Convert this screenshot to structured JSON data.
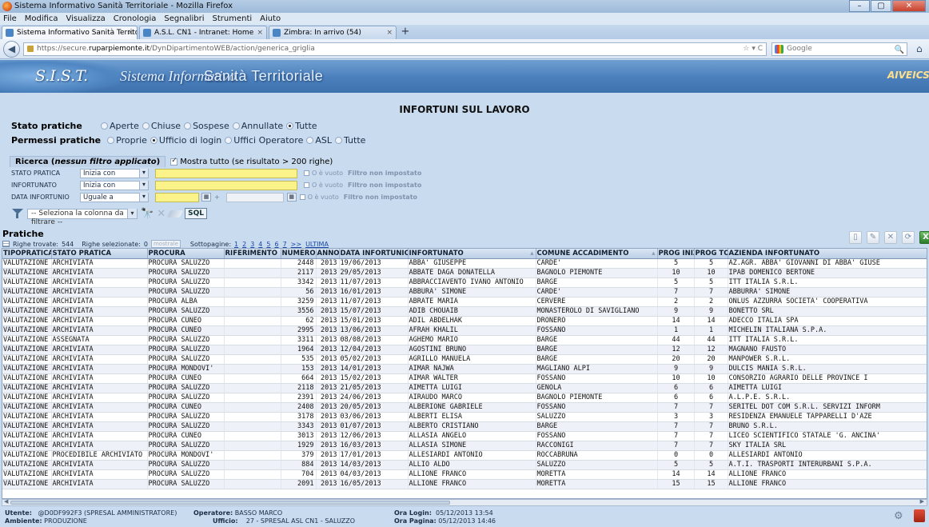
{
  "browser": {
    "window_title": "Sistema Informativo Sanità Territoriale - Mozilla Firefox",
    "controls": {
      "minimize": "–",
      "maximize": "▢",
      "close": "✕"
    },
    "menu": [
      "File",
      "Modifica",
      "Visualizza",
      "Cronologia",
      "Segnalibri",
      "Strumenti",
      "Aiuto"
    ],
    "tabs": [
      {
        "label": "Sistema Informativo Sanità Territoriale",
        "active": true
      },
      {
        "label": "A.S.L. CN1 - Intranet: Home",
        "active": false
      },
      {
        "label": "Zimbra: In arrivo (54)",
        "active": false
      }
    ],
    "tab_close": "×",
    "new_tab": "+",
    "url_prefix": "https://secure.",
    "url_domain": "ruparpiemonte.it",
    "url_path": "/DynDipartimentoWEB/action/generica_griglia",
    "url_right": "☆ ▾ C",
    "search_placeholder": "Google",
    "back": "◀",
    "search_button": "🔍",
    "home": "⌂"
  },
  "header": {
    "logo": "S.I.S.T.",
    "title_italic": "Sistema Informativo",
    "title_main": "Sanità Territoriale",
    "vendor": "AIVEICS"
  },
  "page": {
    "title": "INFORTUNI SUL LAVORO"
  },
  "stato": {
    "label": "Stato pratiche",
    "options": [
      "Aperte",
      "Chiuse",
      "Sospese",
      "Annullate",
      "Tutte"
    ],
    "selected": 4
  },
  "permessi": {
    "label": "Permessi pratiche",
    "options": [
      "Proprie",
      "Ufficio di login",
      "Uffici Operatore",
      "ASL",
      "Tutte"
    ],
    "selected": 1
  },
  "ricerca": {
    "title_prefix": "Ricerca (",
    "title_em": "nessun filtro applicato",
    "title_suffix": ")",
    "show_all": "Mostra tutto (se risultato > 200 righe)",
    "show_all_checked": true,
    "criteria": [
      {
        "label": "STATO PRATICA",
        "op": "Inizia con",
        "empty": "O è vuoto",
        "status": "Filtro non impostato"
      },
      {
        "label": "INFORTUNATO",
        "op": "Inizia con",
        "empty": "O è vuoto",
        "status": "Filtro non impostato"
      },
      {
        "label": "DATA INFORTUNIO",
        "op": "Uguale a",
        "plus": "+",
        "empty": "O è vuoto",
        "status": "Filtro non impostato"
      }
    ],
    "column_select": "-- Seleziona la colonna da filtrare --",
    "sql_label": "SQL"
  },
  "pratiche": {
    "title": "Pratiche",
    "rows_found_label": "Righe trovate:",
    "rows_found": "544",
    "rows_selected_label": "Righe selezionate:",
    "rows_selected": "0",
    "show_button": "mostrale",
    "subpages_label": "Sottopagine:",
    "subpages": [
      "1",
      "2",
      "3",
      "4",
      "5",
      "6",
      "7",
      ">>",
      "ULTIMA"
    ]
  },
  "grid": {
    "columns": [
      "TIPOPRATICA",
      "STATO PRATICA",
      "PROCURA",
      "RIFERIMENTO",
      "NUMERO",
      "ANNO",
      "DATA INFORTUNIO",
      "INFORTUNATO",
      "COMUNE ACCADIMENTO",
      "PROG INIZ",
      "PROG TOT",
      "AZIENDA INFORTUNATO"
    ],
    "sort_marks": {
      "INFORTUNATO": "▴",
      "COMUNE ACCADIMENTO": "▴"
    },
    "rows": [
      [
        "VALUTAZIONE",
        "ARCHIVIATA",
        "PROCURA SALUZZO",
        "",
        "2448",
        "2013",
        "19/06/2013",
        "ABBA' GIUSEPPE",
        "CARDE'",
        "5",
        "5",
        "AZ.AGR. ABBA' GIOVANNI DI ABBA' GIUSE"
      ],
      [
        "VALUTAZIONE",
        "ARCHIVIATA",
        "PROCURA SALUZZO",
        "",
        "2117",
        "2013",
        "29/05/2013",
        "ABBATE DAGA DONATELLA",
        "BAGNOLO PIEMONTE",
        "10",
        "10",
        "IPAB DOMENICO BERTONE"
      ],
      [
        "VALUTAZIONE",
        "ARCHIVIATA",
        "PROCURA SALUZZO",
        "",
        "3342",
        "2013",
        "11/07/2013",
        "ABBRACCIAVENTO IVANO ANTONIO",
        "BARGE",
        "5",
        "5",
        "ITT ITALIA S.R.L."
      ],
      [
        "VALUTAZIONE",
        "ARCHIVIATA",
        "PROCURA SALUZZO",
        "",
        "56",
        "2013",
        "16/01/2013",
        "ABBURA' SIMONE",
        "CARDE'",
        "7",
        "7",
        "ABBURRA' SIMONE"
      ],
      [
        "VALUTAZIONE",
        "ARCHIVIATA",
        "PROCURA ALBA",
        "",
        "3259",
        "2013",
        "11/07/2013",
        "ABRATE MARIA",
        "CERVERE",
        "2",
        "2",
        "ONLUS AZZURRA SOCIETA' COOPERATIVA"
      ],
      [
        "VALUTAZIONE",
        "ARCHIVIATA",
        "PROCURA SALUZZO",
        "",
        "3556",
        "2013",
        "15/07/2013",
        "ADIB CHOUAIB",
        "MONASTEROLO DI SAVIGLIANO",
        "9",
        "9",
        "BONETTO SRL"
      ],
      [
        "VALUTAZIONE",
        "ARCHIVIATA",
        "PROCURA CUNEO",
        "",
        "62",
        "2013",
        "15/01/2013",
        "ADIL ABDELHAK",
        "DRONERO",
        "14",
        "14",
        "ADECCO ITALIA SPA"
      ],
      [
        "VALUTAZIONE",
        "ARCHIVIATA",
        "PROCURA CUNEO",
        "",
        "2995",
        "2013",
        "13/06/2013",
        "AFRAH KHALIL",
        "FOSSANO",
        "1",
        "1",
        "MICHELIN ITALIANA S.P.A."
      ],
      [
        "VALUTAZIONE",
        "ASSEGNATA",
        "PROCURA SALUZZO",
        "",
        "3311",
        "2013",
        "08/08/2013",
        "AGHEMO MARIO",
        "BARGE",
        "44",
        "44",
        "ITT ITALIA S.R.L."
      ],
      [
        "VALUTAZIONE",
        "ARCHIVIATA",
        "PROCURA SALUZZO",
        "",
        "1964",
        "2013",
        "12/04/2013",
        "AGOSTINI BRUNO",
        "BARGE",
        "12",
        "12",
        "MAGNANO FAUSTO"
      ],
      [
        "VALUTAZIONE",
        "ARCHIVIATA",
        "PROCURA SALUZZO",
        "",
        "535",
        "2013",
        "05/02/2013",
        "AGRILLO MANUELA",
        "BARGE",
        "20",
        "20",
        "MANPOWER S.R.L."
      ],
      [
        "VALUTAZIONE",
        "ARCHIVIATA",
        "PROCURA MONDOVI'",
        "",
        "153",
        "2013",
        "14/01/2013",
        "AIMAR NAJWA",
        "MAGLIANO ALPI",
        "9",
        "9",
        "DULCIS MANIA S.R.L."
      ],
      [
        "VALUTAZIONE",
        "ARCHIVIATA",
        "PROCURA CUNEO",
        "",
        "664",
        "2013",
        "15/02/2013",
        "AIMAR WALTER",
        "FOSSANO",
        "10",
        "10",
        "CONSORZIO AGRARIO DELLE PROVINCE I"
      ],
      [
        "VALUTAZIONE",
        "ARCHIVIATA",
        "PROCURA SALUZZO",
        "",
        "2118",
        "2013",
        "21/05/2013",
        "AIMETTA LUIGI",
        "GENOLA",
        "6",
        "6",
        "AIMETTA LUIGI"
      ],
      [
        "VALUTAZIONE",
        "ARCHIVIATA",
        "PROCURA SALUZZO",
        "",
        "2391",
        "2013",
        "24/06/2013",
        "AIRAUDO MARCO",
        "BAGNOLO PIEMONTE",
        "6",
        "6",
        "A.L.P.E. S.R.L."
      ],
      [
        "VALUTAZIONE",
        "ARCHIVIATA",
        "PROCURA CUNEO",
        "",
        "2408",
        "2013",
        "20/05/2013",
        "ALBERIONE GABRIELE",
        "FOSSANO",
        "7",
        "7",
        "SERITEL DOT COM S.R.L. SERVIZI INFORM"
      ],
      [
        "VALUTAZIONE",
        "ARCHIVIATA",
        "PROCURA SALUZZO",
        "",
        "3178",
        "2013",
        "03/06/2013",
        "ALBERTI ELISA",
        "SALUZZO",
        "3",
        "3",
        "RESIDENZA EMANUELE TAPPARELLI D'AZE"
      ],
      [
        "VALUTAZIONE",
        "ARCHIVIATA",
        "PROCURA SALUZZO",
        "",
        "3343",
        "2013",
        "01/07/2013",
        "ALBERTO CRISTIANO",
        "BARGE",
        "7",
        "7",
        "BRUNO S.R.L."
      ],
      [
        "VALUTAZIONE",
        "ARCHIVIATA",
        "PROCURA CUNEO",
        "",
        "3013",
        "2013",
        "12/06/2013",
        "ALLASIA ANGELO",
        "FOSSANO",
        "7",
        "7",
        "LICEO SCIENTIFICO STATALE 'G. ANCINA'"
      ],
      [
        "VALUTAZIONE",
        "ARCHIVIATA",
        "PROCURA SALUZZO",
        "",
        "1929",
        "2013",
        "16/03/2013",
        "ALLASIA SIMONE",
        "RACCONIGI",
        "7",
        "7",
        "SKY ITALIA SRL"
      ],
      [
        "VALUTAZIONE",
        "PROCEDIBILE ARCHIVIATO",
        "PROCURA MONDOVI'",
        "",
        "379",
        "2013",
        "17/01/2013",
        "ALLESIARDI ANTONIO",
        "ROCCABRUNA",
        "0",
        "0",
        "ALLESIARDI ANTONIO"
      ],
      [
        "VALUTAZIONE",
        "ARCHIVIATA",
        "PROCURA SALUZZO",
        "",
        "884",
        "2013",
        "14/03/2013",
        "ALLIO ALDO",
        "SALUZZO",
        "5",
        "5",
        "A.T.I. TRASPORTI INTERURBANI S.P.A."
      ],
      [
        "VALUTAZIONE",
        "ARCHIVIATA",
        "PROCURA SALUZZO",
        "",
        "704",
        "2013",
        "04/03/2013",
        "ALLIONE FRANCO",
        "MORETTA",
        "14",
        "14",
        "ALLIONE FRANCO"
      ],
      [
        "VALUTAZIONE",
        "ARCHIVIATA",
        "PROCURA SALUZZO",
        "",
        "2091",
        "2013",
        "16/05/2013",
        "ALLIONE FRANCO",
        "MORETTA",
        "15",
        "15",
        "ALLIONE FRANCO"
      ]
    ]
  },
  "scroll": {
    "left": "◀",
    "right": "▶"
  },
  "status": {
    "utente_label": "Utente:",
    "utente": "@D0DF992F3 (SPRESAL AMMINISTRATORE)",
    "ambiente_label": "Ambiente:",
    "ambiente": "PRODUZIONE",
    "operatore_label": "Operatore:",
    "operatore": "BASSO MARCO",
    "ufficio_label": "Ufficio:",
    "ufficio": "27 - SPRESAL ASL CN1 - SALUZZO",
    "login_label": "Ora Login:",
    "login": "05/12/2013 13:54",
    "pagina_label": "Ora Pagina:",
    "pagina": "05/12/2013 14:46"
  }
}
